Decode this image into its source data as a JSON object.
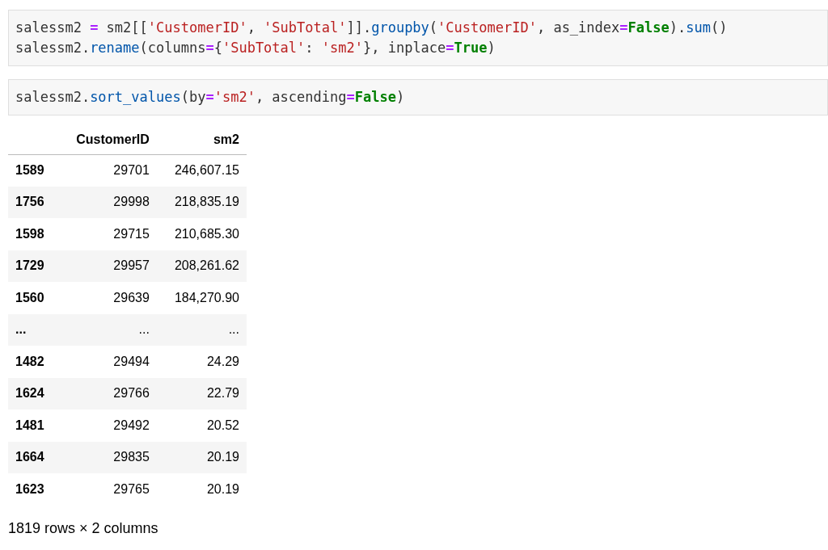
{
  "cells": [
    {
      "lines": [
        [
          {
            "kind": "plain",
            "text": "salessm2 "
          },
          {
            "kind": "op",
            "text": "="
          },
          {
            "kind": "plain",
            "text": " sm2[["
          },
          {
            "kind": "str",
            "text": "'CustomerID'"
          },
          {
            "kind": "plain",
            "text": ", "
          },
          {
            "kind": "str",
            "text": "'SubTotal'"
          },
          {
            "kind": "plain",
            "text": "]]."
          },
          {
            "kind": "func",
            "text": "groupby"
          },
          {
            "kind": "plain",
            "text": "("
          },
          {
            "kind": "str",
            "text": "'CustomerID'"
          },
          {
            "kind": "plain",
            "text": ", as_index"
          },
          {
            "kind": "op",
            "text": "="
          },
          {
            "kind": "kw",
            "text": "False"
          },
          {
            "kind": "plain",
            "text": ")."
          },
          {
            "kind": "func",
            "text": "sum"
          },
          {
            "kind": "plain",
            "text": "()"
          }
        ],
        [
          {
            "kind": "plain",
            "text": "salessm2."
          },
          {
            "kind": "func",
            "text": "rename"
          },
          {
            "kind": "plain",
            "text": "(columns"
          },
          {
            "kind": "op",
            "text": "="
          },
          {
            "kind": "plain",
            "text": "{"
          },
          {
            "kind": "str",
            "text": "'SubTotal'"
          },
          {
            "kind": "plain",
            "text": ": "
          },
          {
            "kind": "str",
            "text": "'sm2'"
          },
          {
            "kind": "plain",
            "text": "}, inplace"
          },
          {
            "kind": "op",
            "text": "="
          },
          {
            "kind": "kw",
            "text": "True"
          },
          {
            "kind": "plain",
            "text": ")"
          }
        ]
      ]
    },
    {
      "lines": [
        [
          {
            "kind": "plain",
            "text": "salessm2."
          },
          {
            "kind": "func",
            "text": "sort_values"
          },
          {
            "kind": "plain",
            "text": "(by"
          },
          {
            "kind": "op",
            "text": "="
          },
          {
            "kind": "str",
            "text": "'sm2'"
          },
          {
            "kind": "plain",
            "text": ", ascending"
          },
          {
            "kind": "op",
            "text": "="
          },
          {
            "kind": "kw",
            "text": "False"
          },
          {
            "kind": "plain",
            "text": ")"
          }
        ]
      ]
    }
  ],
  "table": {
    "columns": [
      "CustomerID",
      "sm2"
    ],
    "rows": [
      {
        "index": "1589",
        "values": [
          "29701",
          "246,607.15"
        ]
      },
      {
        "index": "1756",
        "values": [
          "29998",
          "218,835.19"
        ]
      },
      {
        "index": "1598",
        "values": [
          "29715",
          "210,685.30"
        ]
      },
      {
        "index": "1729",
        "values": [
          "29957",
          "208,261.62"
        ]
      },
      {
        "index": "1560",
        "values": [
          "29639",
          "184,270.90"
        ]
      },
      {
        "index": "...",
        "values": [
          "...",
          "..."
        ]
      },
      {
        "index": "1482",
        "values": [
          "29494",
          "24.29"
        ]
      },
      {
        "index": "1624",
        "values": [
          "29766",
          "22.79"
        ]
      },
      {
        "index": "1481",
        "values": [
          "29492",
          "20.52"
        ]
      },
      {
        "index": "1664",
        "values": [
          "29835",
          "20.19"
        ]
      },
      {
        "index": "1623",
        "values": [
          "29765",
          "20.19"
        ]
      }
    ]
  },
  "summary": "1819 rows × 2 columns"
}
